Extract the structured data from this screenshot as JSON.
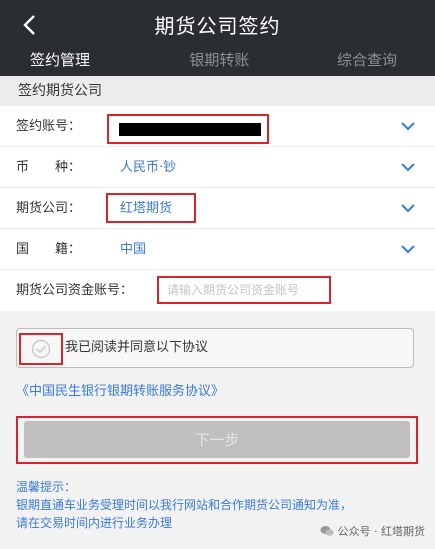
{
  "header": {
    "title": "期货公司签约",
    "tabs": [
      {
        "label": "签约管理",
        "active": true
      },
      {
        "label": "银期转账",
        "active": false
      },
      {
        "label": "综合查询",
        "active": false
      }
    ]
  },
  "section": {
    "title": "签约期货公司"
  },
  "form": {
    "account": {
      "label": "签约账号："
    },
    "currency": {
      "label": "币　　种：",
      "value": "人民币·钞"
    },
    "company": {
      "label": "期货公司：",
      "value": "红塔期货"
    },
    "nationality": {
      "label": "国　　籍：",
      "value": "中国"
    },
    "fund_account": {
      "label": "期货公司资金账号：",
      "placeholder": "请输入期货公司资金账号"
    }
  },
  "agreement": {
    "text": "我已阅读并同意以下协议",
    "link": "《中国民生银行银期转账服务协议》"
  },
  "next_button": {
    "label": "下一步"
  },
  "tips": {
    "title": "温馨提示：",
    "line1": "银期直通车业务受理时间以我行网站和合作期货公司通知为准，",
    "line2": "请在交易时间内进行业务办理"
  },
  "watermark": {
    "text": "公众号 · 红塔期货"
  },
  "colors": {
    "header_bg": "#2a2d31",
    "link_blue": "#3a7bd5",
    "highlight_red": "#d9232d"
  }
}
